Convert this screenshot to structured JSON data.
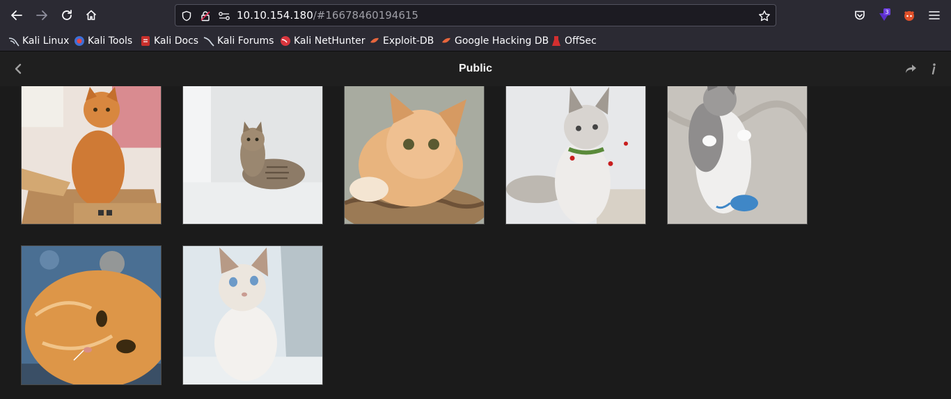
{
  "browser": {
    "url_host": "10.10.154.180",
    "url_rest": "/#16678460194615",
    "extension_badge": "3"
  },
  "bookmarks": [
    {
      "label": "Kali Linux",
      "icon": "kali-dragon-icon"
    },
    {
      "label": "Kali Tools",
      "icon": "kali-tools-icon"
    },
    {
      "label": "Kali Docs",
      "icon": "kali-docs-icon"
    },
    {
      "label": "Kali Forums",
      "icon": "kali-forums-icon"
    },
    {
      "label": "Kali NetHunter",
      "icon": "nethunter-icon"
    },
    {
      "label": "Exploit-DB",
      "icon": "exploitdb-icon"
    },
    {
      "label": "Google Hacking DB",
      "icon": "ghdb-icon"
    },
    {
      "label": "OffSec",
      "icon": "offsec-icon"
    }
  ],
  "gallery": {
    "title": "Public",
    "photos": [
      {
        "subject": "orange tabby cat sitting in cardboard box"
      },
      {
        "subject": "tabby cat lying on white floor"
      },
      {
        "subject": "ginger cat in wicker basket"
      },
      {
        "subject": "fluffy grey-white cat with collar"
      },
      {
        "subject": "grey and white kitten on back with toy"
      },
      {
        "subject": "ginger fluffy cat lying down"
      },
      {
        "subject": "white kitten with blue eyes"
      }
    ]
  },
  "colors": {
    "browser_chrome": "#2b2a33",
    "url_field": "#1c1b22",
    "page_bg": "#1b1b1b",
    "header_bg": "#1f1f1f",
    "extension_badge": "#5b2fc9"
  }
}
